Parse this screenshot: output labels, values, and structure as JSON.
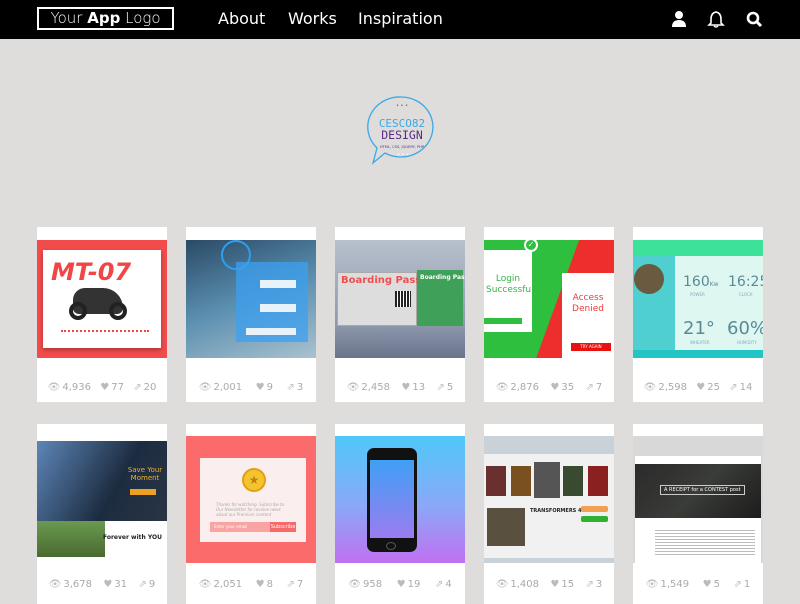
{
  "nav": {
    "logo_prefix": "Your ",
    "logo_bold": "App",
    "logo_suffix": " Logo",
    "items": [
      "About",
      "Works",
      "Inspiration"
    ],
    "icons": [
      "user-icon",
      "bell-icon",
      "search-icon"
    ]
  },
  "badge": {
    "line1": "CESCO82",
    "line2": "DESIGN",
    "tagline": "HTML, CSS, JQUERY, PHP",
    "colors": {
      "blue": "#3aa8e8",
      "purple": "#5b2a86"
    }
  },
  "cards": [
    {
      "title": "MT-07",
      "views": "4,936",
      "likes": "77",
      "shares": "20"
    },
    {
      "title": "",
      "views": "2,001",
      "likes": "9",
      "shares": "3"
    },
    {
      "title": "Boarding Pass",
      "views": "2,458",
      "likes": "13",
      "shares": "5"
    },
    {
      "title": "Login Successfull",
      "title2": "Access Denied",
      "button": "TRY AGAIN",
      "views": "2,876",
      "likes": "35",
      "shares": "7"
    },
    {
      "v1": "160",
      "v1u": "Kw",
      "v1l": "POWER",
      "v2": "16:25",
      "v2l": "CLOCK",
      "v3": "21°",
      "v3l": "WHEATER",
      "v4": "60%",
      "v4l": "HUMIDITY",
      "views": "2,598",
      "likes": "25",
      "shares": "14"
    },
    {
      "title": "Save Your Moment",
      "title2": "Forever with YOU",
      "views": "3,678",
      "likes": "31",
      "shares": "9"
    },
    {
      "text": "Thanks for watching. Subscribe to Our Newsletter for receive news about our Premium content",
      "placeholder": "Enter your email",
      "button": "Subscribe",
      "views": "2,051",
      "likes": "8",
      "shares": "7"
    },
    {
      "views": "958",
      "likes": "19",
      "shares": "4"
    },
    {
      "title": "TRANSFORMERS 4",
      "views": "1,408",
      "likes": "15",
      "shares": "3"
    },
    {
      "title": "A RECEIPT for a CONTEST post",
      "views": "1,549",
      "likes": "5",
      "shares": "1"
    }
  ],
  "stat_icons": [
    "eye-icon",
    "heart-icon",
    "share-icon"
  ]
}
